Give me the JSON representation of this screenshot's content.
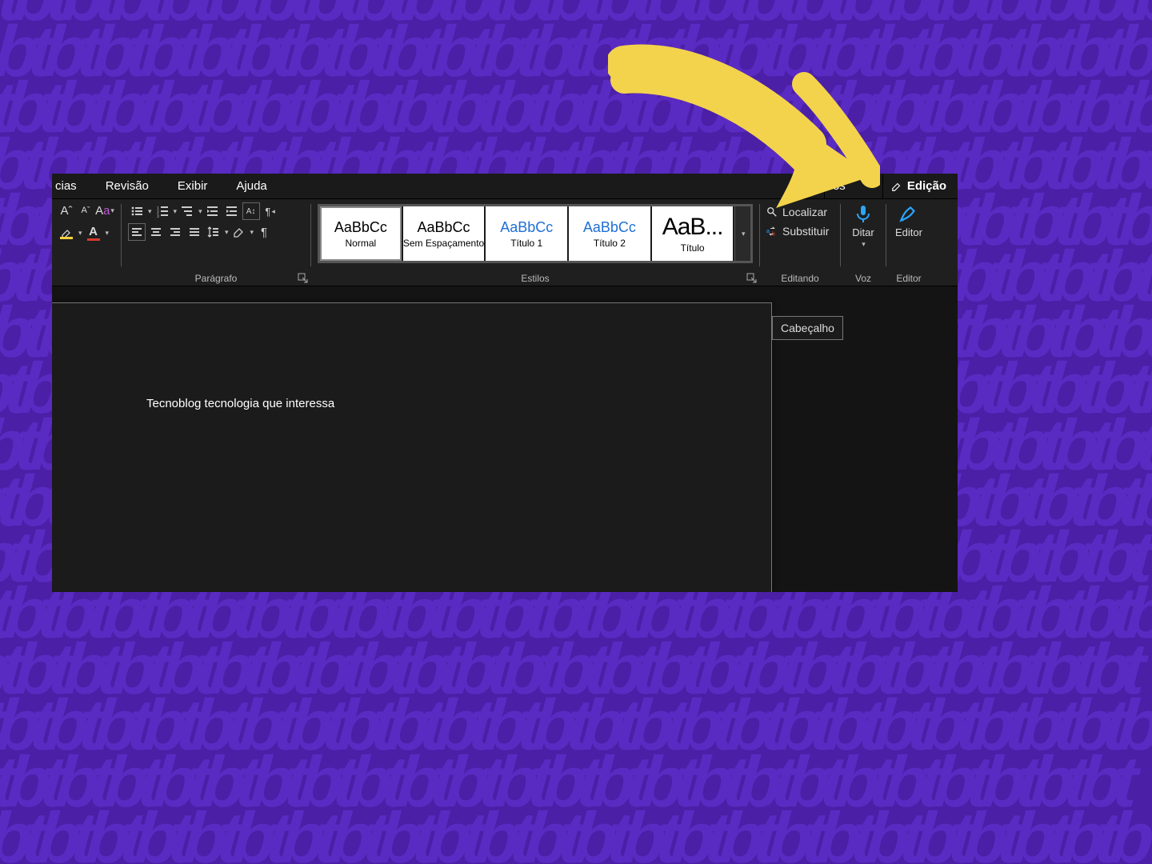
{
  "tabs": {
    "referencias_partial": "cias",
    "revisao": "Revisão",
    "exibir": "Exibir",
    "ajuda": "Ajuda",
    "comentarios_partial": "os",
    "edicao_partial": "Edição"
  },
  "ribbon": {
    "groups": {
      "paragrafo_label": "Parágrafo",
      "estilos_label": "Estilos",
      "editando_label": "Editando",
      "voz_label": "Voz",
      "editor_label": "Editor"
    },
    "styles": [
      {
        "sample": "AaBbCc",
        "name": "Normal",
        "class": ""
      },
      {
        "sample": "AaBbCc",
        "name": "Sem Espaçamento",
        "class": ""
      },
      {
        "sample": "AaBbCc",
        "name": "Título 1",
        "class": "blue"
      },
      {
        "sample": "AaBbCc",
        "name": "Título 2",
        "class": "blue"
      },
      {
        "sample": "AaB...",
        "name": "Título",
        "class": "big"
      }
    ],
    "editing": {
      "localizar": "Localizar",
      "substituir": "Substituir"
    },
    "voice": {
      "ditar": "Ditar"
    },
    "editor_btn": "Editor"
  },
  "document": {
    "text": "Tecnoblog tecnologia que interessa",
    "header_tag": "Cabeçalho"
  },
  "colors": {
    "accent_blue": "#1e6fd6",
    "mic_blue": "#2aa6ff",
    "editor_pen_blue": "#2aa6ff",
    "highlight_yellow": "#f8d23c",
    "font_color_red": "#d93a2b"
  }
}
